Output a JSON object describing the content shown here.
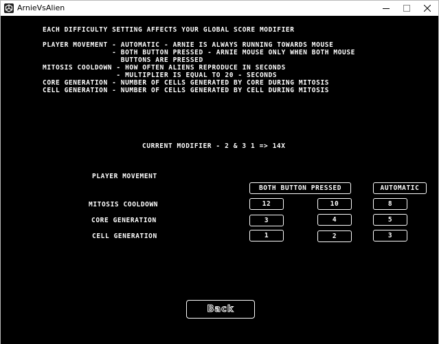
{
  "window": {
    "title": "ArnieVsAlien"
  },
  "info": {
    "lines": [
      "EACH DIFFICULTY SETTING AFFECTS YOUR GLOBAL SCORE MODIFIER",
      "",
      "PLAYER MOVEMENT - AUTOMATIC - ARNIE IS ALWAYS RUNNING TOWARDS MOUSE",
      "                - BOTH BUTTON PRESSED - ARNIE MOUSE ONLY WHEN BOTH MOUSE",
      "                  BUTTONS ARE PRESSED",
      "MITOSIS COOLDOWN - HOW OFTEN ALIENS REPRODUCE IN SECONDS",
      "                 - MULTIPLIER IS EQUAL TO 20 - SECONDS",
      "CORE GENERATION - NUMBER OF CELLS GENERATED BY CORE DURING MITOSIS",
      "CELL GENERATION - NUMBER OF CELLS GENERATED BY CELL DURING MITOSIS"
    ]
  },
  "modifier": {
    "text": "CURRENT MODIFIER - 2 & 3 1 => 14X"
  },
  "settings": {
    "player_movement": {
      "label": "PLAYER MOVEMENT",
      "options": [
        "BOTH BUTTON PRESSED",
        "AUTOMATIC"
      ]
    },
    "mitosis_cooldown": {
      "label": "MITOSIS COOLDOWN",
      "options": [
        "12",
        "10",
        "8"
      ]
    },
    "core_generation": {
      "label": "CORE GENERATION",
      "options": [
        "3",
        "4",
        "5"
      ]
    },
    "cell_generation": {
      "label": "CELL GENERATION",
      "options": [
        "1",
        "2",
        "3"
      ]
    }
  },
  "back_button": {
    "label": "Back"
  }
}
